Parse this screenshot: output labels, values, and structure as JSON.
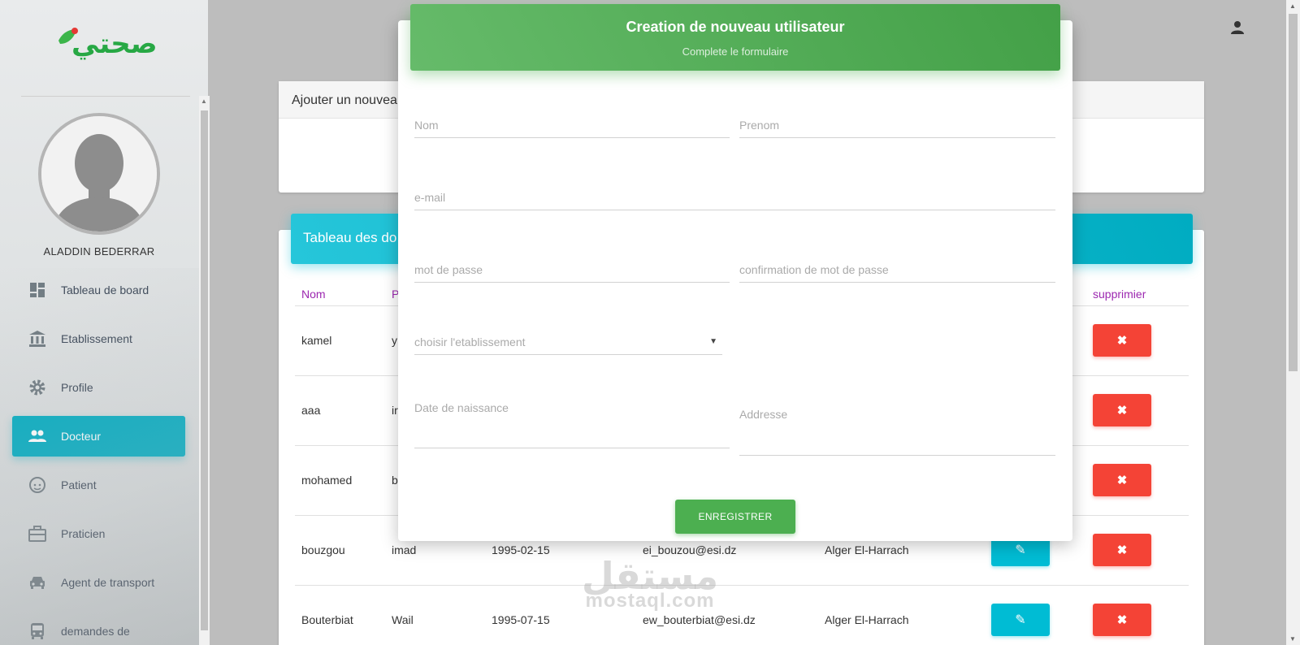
{
  "app": {
    "logo_text": "صحتي",
    "user_name": "ALADDIN BEDERRAR"
  },
  "sidebar": {
    "items": [
      {
        "label": "Tableau de board",
        "icon": "dashboard-icon"
      },
      {
        "label": "Etablissement",
        "icon": "bank-icon"
      },
      {
        "label": "Profile",
        "icon": "gear-icon"
      },
      {
        "label": "Docteur",
        "icon": "people-icon",
        "active": true
      },
      {
        "label": "Patient",
        "icon": "face-icon"
      },
      {
        "label": "Praticien",
        "icon": "briefcase-icon"
      },
      {
        "label": "Agent de transport",
        "icon": "car-icon"
      },
      {
        "label": "demandes de",
        "icon": "bus-icon"
      }
    ]
  },
  "main": {
    "add_card_title": "Ajouter un nouvea",
    "table_card_title": "Tableau des do",
    "table": {
      "headers": {
        "nom": "Nom",
        "prenom": "P",
        "supprimer": "supprimier"
      },
      "rows": [
        {
          "nom": "kamel",
          "prenom": "y",
          "date": "",
          "email": "",
          "adresse": ""
        },
        {
          "nom": "aaa",
          "prenom": "ir",
          "date": "",
          "email": "",
          "adresse": ""
        },
        {
          "nom": "mohamed",
          "prenom": "b",
          "date": "",
          "email": "",
          "adresse": ""
        },
        {
          "nom": "bouzgou",
          "prenom": "imad",
          "date": "1995-02-15",
          "email": "ei_bouzou@esi.dz",
          "adresse": "Alger El-Harrach"
        },
        {
          "nom": "Bouterbiat",
          "prenom": "Wail",
          "date": "1995-07-15",
          "email": "ew_bouterbiat@esi.dz",
          "adresse": "Alger El-Harrach"
        }
      ],
      "delete_symbol": "✖",
      "edit_symbol": "✎"
    }
  },
  "modal": {
    "title": "Creation de nouveau utilisateur",
    "subtitle": "Complete le formulaire",
    "fields": {
      "nom": "Nom",
      "prenom": "Prenom",
      "email": "e-mail",
      "password": "mot de passe",
      "password_confirm": "confirmation de mot de passe",
      "etablissement": "choisir l'etablissement",
      "naissance": "Date de naissance",
      "adresse": "Addresse"
    },
    "caret": "▼",
    "save_label": "ENREGISTRER"
  },
  "watermark": {
    "arabic": "مستقل",
    "latin": "mostaql.com"
  },
  "colors": {
    "accent_cyan": "#00acc1",
    "success_green": "#4caf50",
    "danger_red": "#f44336",
    "header_purple": "#9c27b0"
  }
}
